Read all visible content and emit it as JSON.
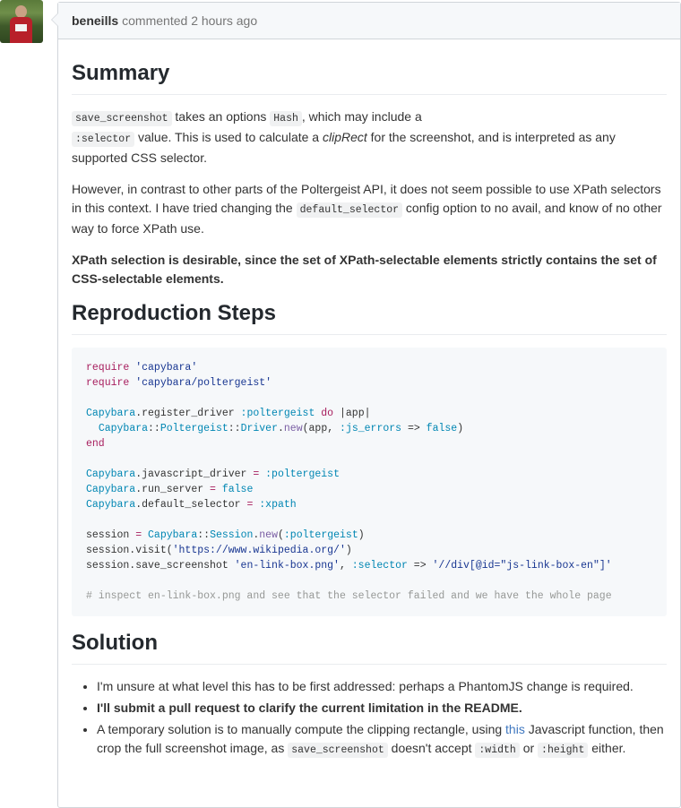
{
  "comment": {
    "author": "beneills",
    "action": "commented",
    "time": "2 hours ago"
  },
  "summary": {
    "heading": "Summary",
    "p1_code1": "save_screenshot",
    "p1_t1": " takes an options ",
    "p1_code2": "Hash",
    "p1_t2": ", which may include a",
    "p1_code3": ":selector",
    "p1_t3": " value. This is used to calculate a ",
    "p1_em": "clipRect",
    "p1_t4": " for the screenshot, and is interpreted as any supported CSS selector.",
    "p2_t1": "However, in contrast to other parts of the Poltergeist API, it does not seem possible to use XPath selectors in this context. I have tried changing the ",
    "p2_code": "default_selector",
    "p2_t2": " config option to no avail, and know of no other way to force XPath use.",
    "p3_bold": "XPath selection is desirable, since the set of XPath-selectable elements strictly contains the set of CSS-selectable elements."
  },
  "repro": {
    "heading": "Reproduction Steps",
    "l1_kw": "require",
    "l1_str": "'capybara'",
    "l2_kw": "require",
    "l2_str": "'capybara/poltergeist'",
    "l3_const": "Capybara",
    "l3_rest": ".register_driver ",
    "l3_sym": ":poltergeist",
    "l3_kw": "do",
    "l3_end": " |app|",
    "l4_c1": "Capybara",
    "l4_sep1": "::",
    "l4_c2": "Poltergeist",
    "l4_sep2": "::",
    "l4_c3": "Driver",
    "l4_dot": ".",
    "l4_fn": "new",
    "l4_args": "(app, ",
    "l4_sym": ":js_errors",
    "l4_arrow": " => ",
    "l4_val": "false",
    "l4_close": ")",
    "l5_kw": "end",
    "l6_const": "Capybara",
    "l6_rest": ".javascript_driver ",
    "l6_eq": "=",
    "l6_sym": " :poltergeist",
    "l7_const": "Capybara",
    "l7_rest": ".run_server ",
    "l7_eq": "=",
    "l7_val": " false",
    "l8_const": "Capybara",
    "l8_rest": ".default_selector ",
    "l8_eq": "=",
    "l8_sym": " :xpath",
    "l9_a": "session ",
    "l9_eq": "=",
    "l9_c1": " Capybara",
    "l9_sep": "::",
    "l9_c2": "Session",
    "l9_dot": ".",
    "l9_fn": "new",
    "l9_open": "(",
    "l9_sym": ":poltergeist",
    "l9_close": ")",
    "l10_a": "session.visit(",
    "l10_str": "'https://www.wikipedia.org/'",
    "l10_close": ")",
    "l11_a": "session.save_screenshot ",
    "l11_str": "'en-link-box.png'",
    "l11_comma": ", ",
    "l11_sym": ":selector",
    "l11_arrow": " => ",
    "l11_str2": "'//div[@id=\"js-link-box-en\"]'",
    "l12_cmt": "# inspect en-link-box.png and see that the selector failed and we have the whole page"
  },
  "solution": {
    "heading": "Solution",
    "item1": "I'm unsure at what level this has to be first addressed: perhaps a PhantomJS change is required.",
    "item2": "I'll submit a pull request to clarify the current limitation in the README.",
    "item3_t1": "A temporary solution is to manually compute the clipping rectangle, using ",
    "item3_link": "this",
    "item3_t2": " Javascript function, then crop the full screenshot image, as ",
    "item3_code1": "save_screenshot",
    "item3_t3": " doesn't accept ",
    "item3_code2": ":width",
    "item3_t4": " or ",
    "item3_code3": ":height",
    "item3_t5": " either."
  }
}
